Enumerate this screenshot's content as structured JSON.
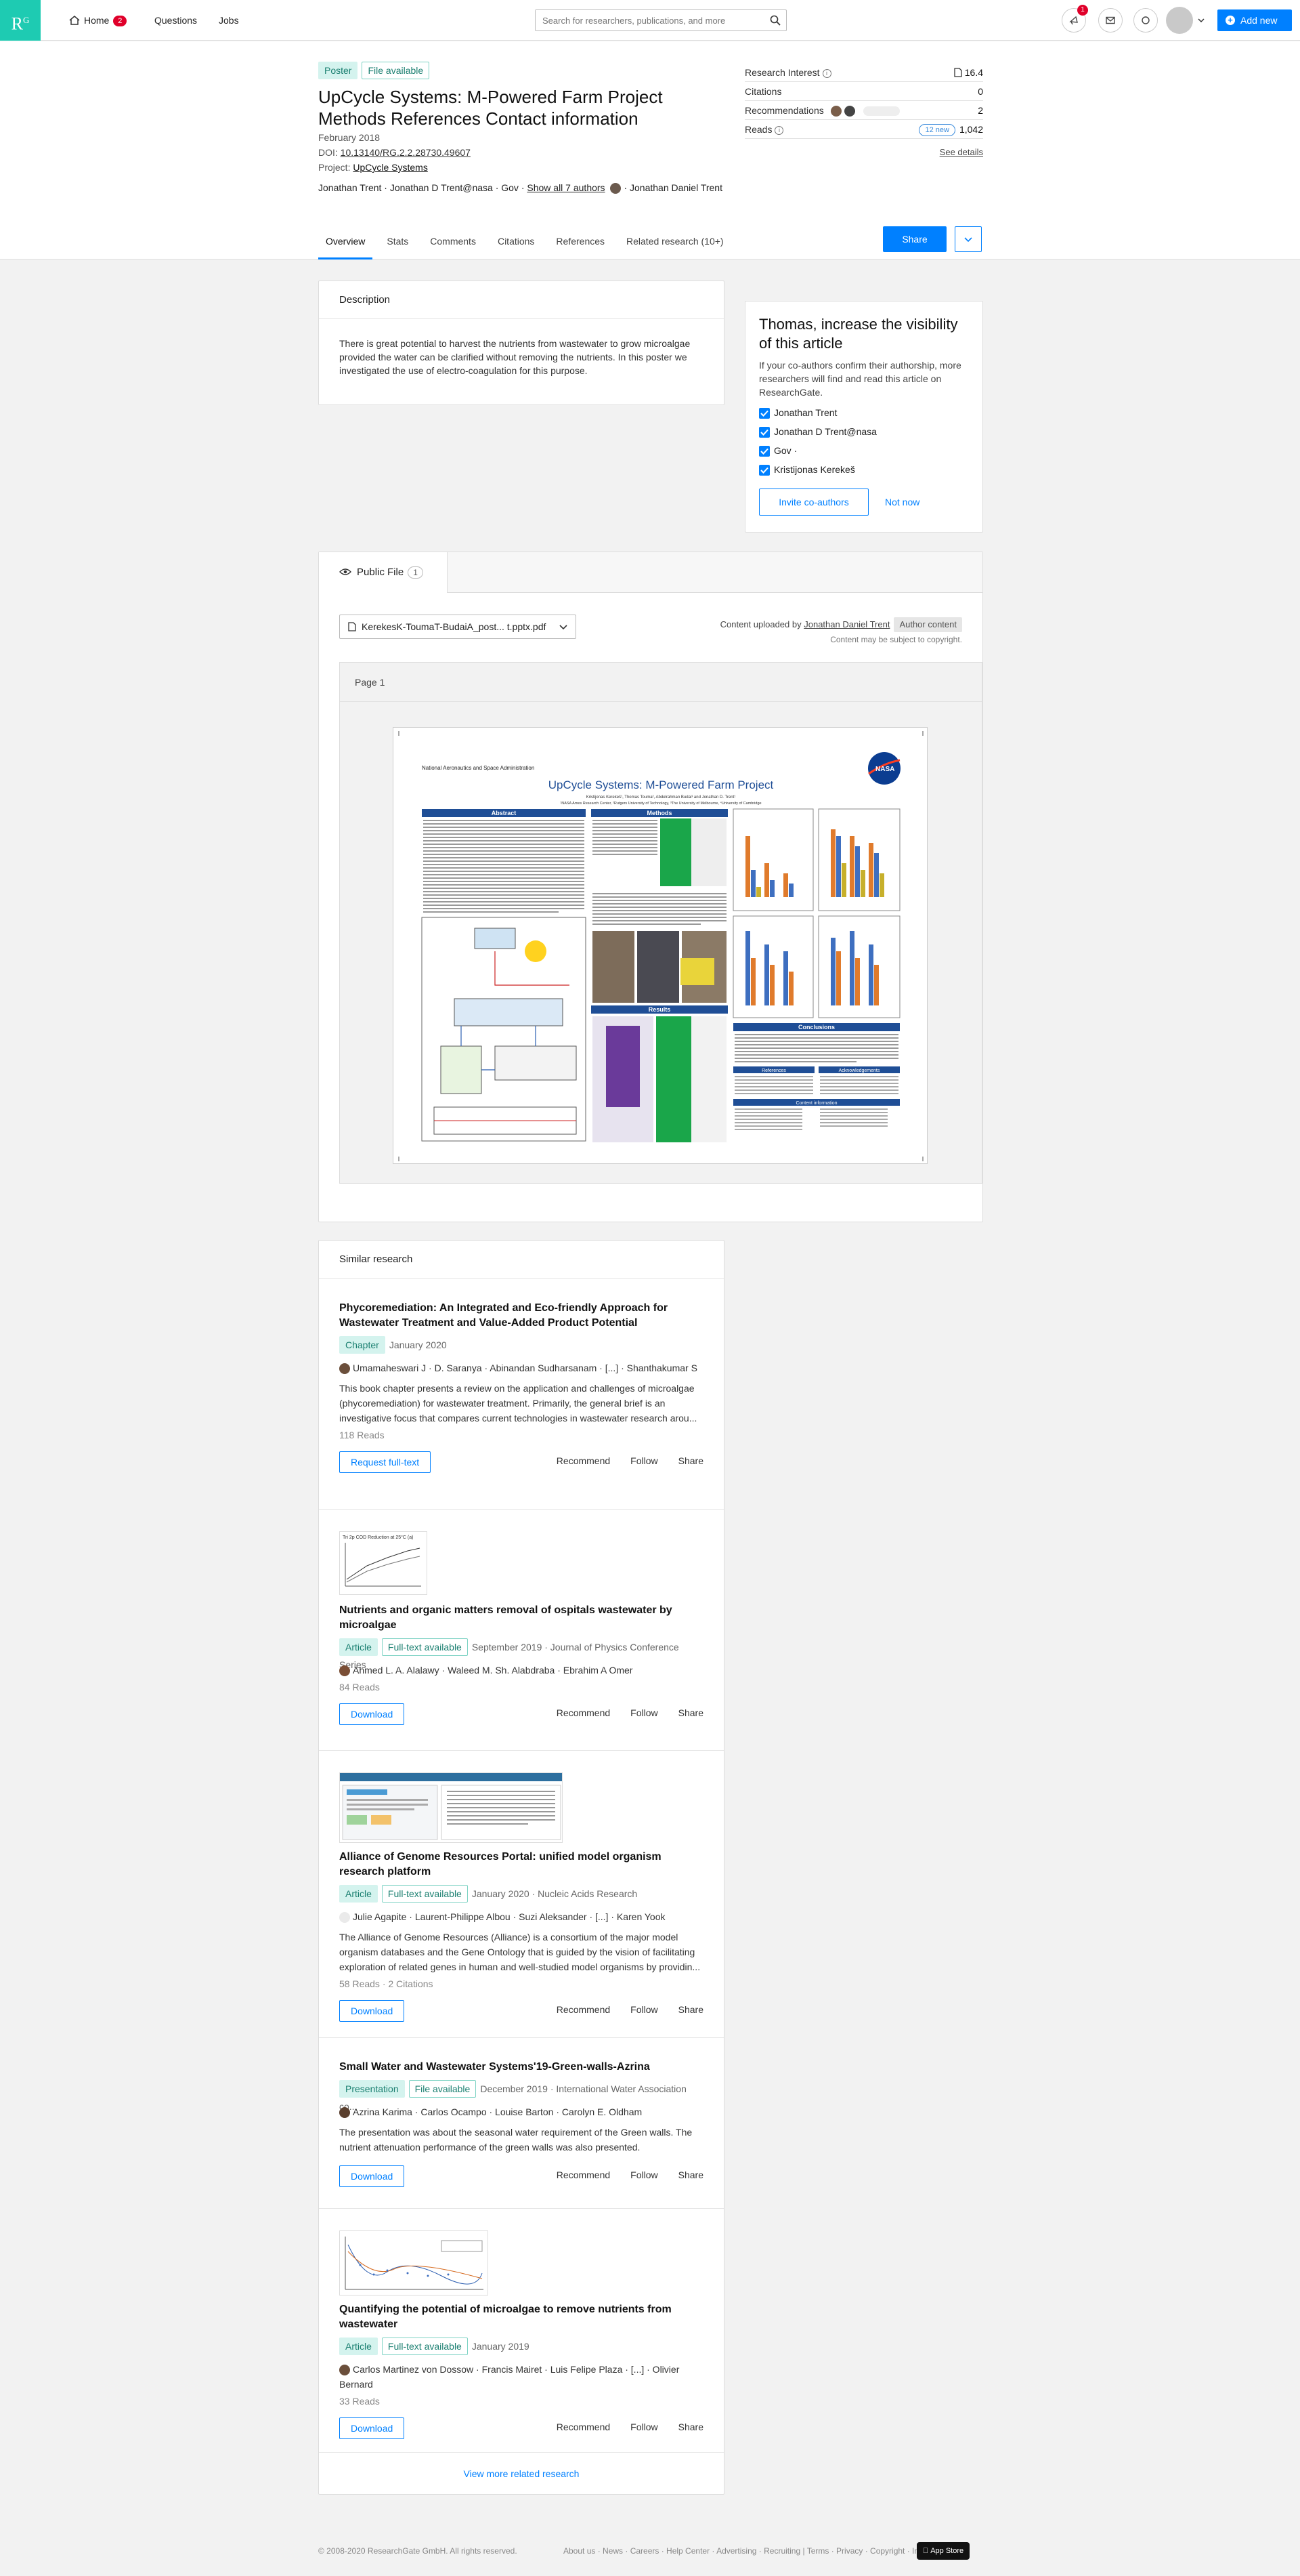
{
  "nav": {
    "logo": "R",
    "logo_sup": "G",
    "home_label": "Home",
    "home_badge": "2",
    "questions_label": "Questions",
    "jobs_label": "Jobs",
    "search_placeholder": "Search for researchers, publications, and more",
    "notif_badge": "1",
    "add_new_label": "Add new"
  },
  "publication": {
    "type_badge": "Poster",
    "file_badge": "File available",
    "title": "UpCycle Systems: M-Powered Farm Project Methods References Contact information",
    "date": "February 2018",
    "doi_label": "DOI:",
    "doi": "10.13140/RG.2.2.28730.49607",
    "project_label": "Project:",
    "project": "UpCycle Systems",
    "authors_prefix": "Jonathan Trent · Jonathan D Trent@nasa · Gov ·",
    "show_all": "Show all 7 authors",
    "authors_suffix": "· Jonathan Daniel Trent"
  },
  "stats": {
    "research_interest_label": "Research Interest",
    "research_interest_value": "16.4",
    "citations_label": "Citations",
    "citations_value": "0",
    "recommendations_label": "Recommendations",
    "recommendations_value": "2",
    "reads_label": "Reads",
    "reads_new": "12 new",
    "reads_value": "1,042",
    "see_details": "See details"
  },
  "tabs": [
    "Overview",
    "Stats",
    "Comments",
    "Citations",
    "References",
    "Related research (10+)"
  ],
  "share_label": "Share",
  "description": {
    "heading": "Description",
    "text": "There is great potential to harvest the nutrients from wastewater to grow microalgae provided the water can be clarified without removing the nutrients. In this poster we investigated the use of electro-coagulation for this purpose."
  },
  "visibility": {
    "title": "Thomas, increase the visibility of this article",
    "subtitle": "If your co-authors confirm their authorship, more researchers will find and read this article on ResearchGate.",
    "coauthors": [
      "Jonathan Trent",
      "Jonathan D Trent@nasa",
      "Gov ·",
      "Kristijonas Kerekeš"
    ],
    "invite_label": "Invite co-authors",
    "not_now_label": "Not now"
  },
  "public_file": {
    "tab_label": "Public File",
    "tab_count": "1",
    "filename": "KerekesK-ToumaT-BudaiA_post... t.pptx.pdf",
    "uploaded_by_prefix": "Content uploaded by",
    "uploaded_by": "Jonathan Daniel Trent",
    "author_content": "Author content",
    "copyright": "Content may be subject to copyright.",
    "page_label": "Page 1"
  },
  "poster": {
    "agency": "National Aeronautics and Space Administration",
    "title": "UpCycle Systems: M-Powered Farm Project",
    "authors": "Kristijonas Kerekeš¹, Thomas Touma², Abdelrahman Budai³ and Jonathan D. Trent¹",
    "affiliations": "¹NASA Ames Research Center, ²Rutgers University of Technology, ³The University of Melbourne, ⁴University of Cambridge",
    "sections": {
      "abstract": "Abstract",
      "methods": "Methods",
      "results": "Results",
      "conclusions": "Conclusions",
      "references": "References",
      "acknowledgements": "Acknowledgements",
      "contact": "Content information"
    },
    "logo": "NASA"
  },
  "similar": {
    "heading": "Similar research",
    "items": [
      {
        "title": "Phycoremediation: An Integrated and Eco-friendly Approach for Wastewater Treatment and Value-Added Product Potential",
        "type": "Chapter",
        "file": "",
        "meta": "January 2020",
        "authors": "Umamaheswari J · D. Saranya · Abinandan Sudharsanam · [...] · Shanthakumar S",
        "abstract": "This book chapter presents a review on the application and challenges of microalgae (phycoremediation) for wastewater treatment. Primarily, the general brief is an investigative focus that compares current technologies in wastewater research arou...",
        "reads": "118 Reads",
        "action": "Request full-text"
      },
      {
        "title": "Nutrients and organic matters removal of ospitals wastewater by microalgae",
        "type": "Article",
        "file": "Full-text available",
        "meta": "September 2019 · Journal of Physics Conference Series",
        "authors": "Ahmed L. A. Alalawy · Waleed M. Sh. Alabdraba · Ebrahim A Omer",
        "abstract": "",
        "reads": "84 Reads",
        "action": "Download",
        "thumb_caption": "Tri 2p COD Reduction at 25°C (a)"
      },
      {
        "title": "Alliance of Genome Resources Portal: unified model organism research platform",
        "type": "Article",
        "file": "Full-text available",
        "meta": "January 2020 · Nucleic Acids Research",
        "authors": "Julie Agapite · Laurent-Philippe Albou · Suzi Aleksander · [...] · Karen Yook",
        "abstract": "The Alliance of Genome Resources (Alliance) is a consortium of the major model organism databases and the Gene Ontology that is guided by the vision of facilitating exploration of related genes in human and well-studied model organisms by providin...",
        "reads": "58 Reads · 2 Citations",
        "action": "Download"
      },
      {
        "title": "Small Water and Wastewater Systems'19-Green-walls-Azrina",
        "type": "Presentation",
        "file": "File available",
        "meta": "December 2019 · International Water Association co...",
        "authors": "Azrina Karima · Carlos Ocampo · Louise Barton · Carolyn E. Oldham",
        "abstract": "The presentation was about the seasonal water requirement of the Green walls. The nutrient attenuation performance of the green walls was also presented.",
        "reads": "",
        "action": "Download"
      },
      {
        "title": "Quantifying the potential of microalgae to remove nutrients from wastewater",
        "type": "Article",
        "file": "Full-text available",
        "meta": "January 2019",
        "authors": "Carlos Martinez von Dossow · Francis Mairet · Luis Felipe Plaza · [...] · Olivier Bernard",
        "abstract": "",
        "reads": "33 Reads",
        "action": "Download"
      }
    ],
    "actions": {
      "recommend": "Recommend",
      "follow": "Follow",
      "share": "Share"
    },
    "view_more": "View more related research"
  },
  "footer": {
    "copyright": "© 2008-2020 ResearchGate GmbH. All rights reserved.",
    "links": "About us · News · Careers · Help Center · Advertising · Recruiting  |  Terms · Privacy · Copyright · Imprint",
    "app_store": "App Store"
  },
  "colors": {
    "accent": "#0080ff",
    "brand": "#1ecbb2",
    "badge": "#e0002a"
  }
}
